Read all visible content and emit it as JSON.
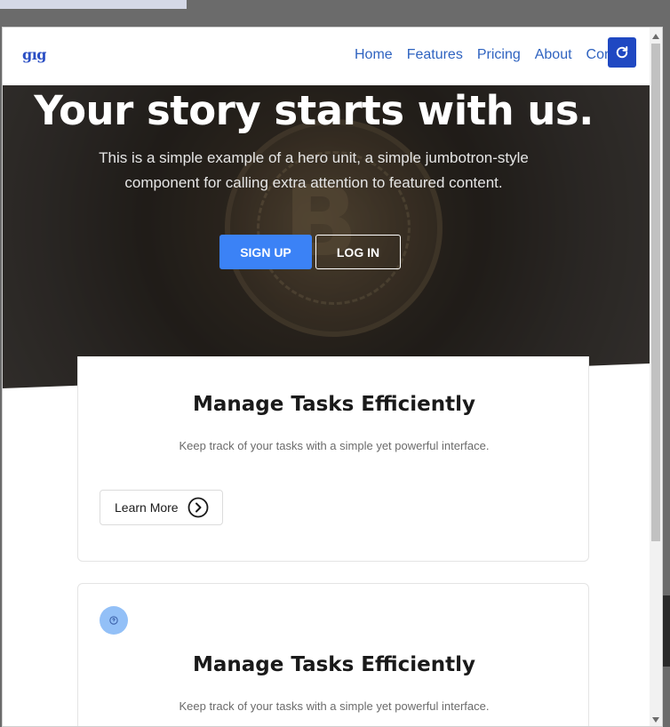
{
  "navbar": {
    "brand": "gıg",
    "links": [
      "Home",
      "Features",
      "Pricing",
      "About",
      "Con"
    ]
  },
  "hero": {
    "title": "Your story starts with us.",
    "subtitle": "This is a simple example of a hero unit, a simple jumbotron-style component for calling extra attention to featured content.",
    "signup_label": "SIGN UP",
    "login_label": "LOG IN"
  },
  "cards": [
    {
      "title": "Manage Tasks Efficiently",
      "text": "Keep track of your tasks with a simple yet powerful interface.",
      "button_label": "Learn More"
    },
    {
      "title": "Manage Tasks Efficiently",
      "text": "Keep track of your tasks with a simple yet powerful interface."
    }
  ],
  "colors": {
    "accent": "#3b82f6",
    "nav_link": "#2f63c0",
    "refresh_button": "#1f48c2",
    "icon_dot": "#93c0f7"
  },
  "icons": {
    "refresh": "refresh-icon",
    "learn_more": "chevron-right-circle-icon",
    "card_icon": "question-circle-icon"
  }
}
